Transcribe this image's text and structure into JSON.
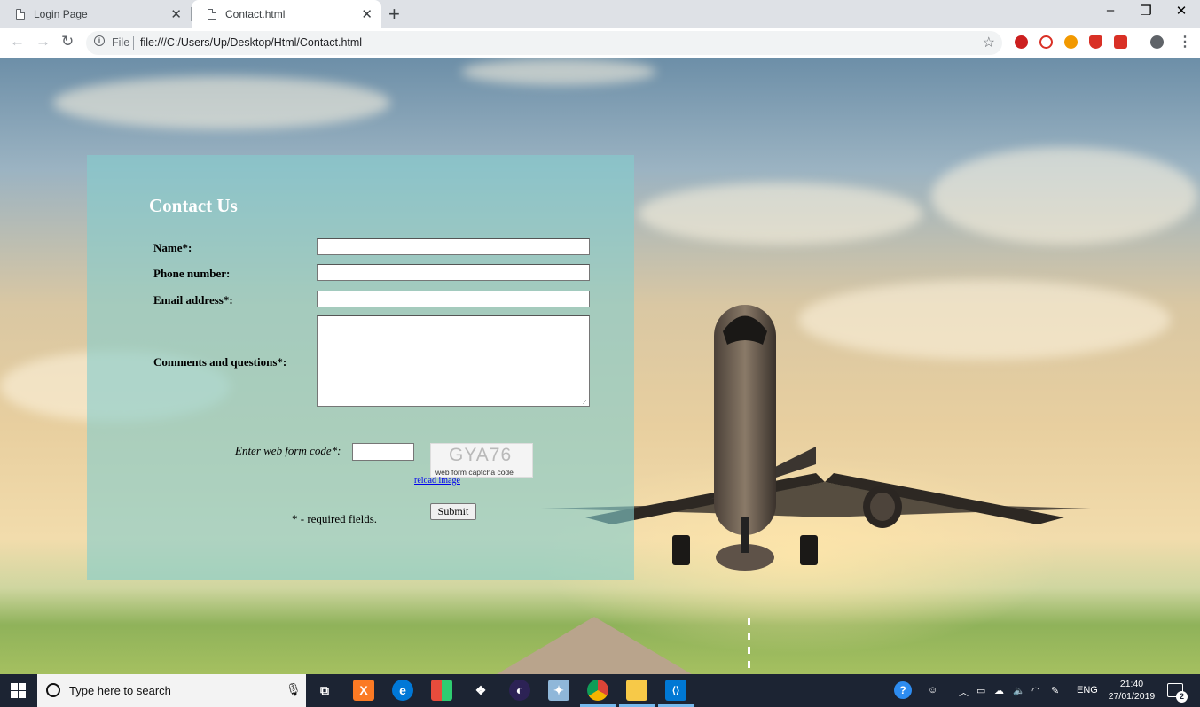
{
  "browser": {
    "tabs": [
      {
        "title": "Login Page",
        "active": false
      },
      {
        "title": "Contact.html",
        "active": true
      }
    ],
    "new_tab": "+",
    "window_controls": {
      "minimize": "‒",
      "maximize": "❐",
      "close": "✕"
    },
    "nav": {
      "back": "←",
      "forward": "→",
      "reload": "↻"
    },
    "omnibox": {
      "info": "i",
      "scheme": "File",
      "url": "file:///C:/Users/Up/Desktop/Html/Contact.html"
    },
    "bookmark_star": "☆",
    "extension_colors": [
      "#cc1f1f",
      "#d93025",
      "#f29900",
      "#d93025",
      "#d93025",
      "#5f6368"
    ],
    "menu": "⋮"
  },
  "contact_form": {
    "title": "Contact Us",
    "fields": [
      {
        "label": "Name*:",
        "value": ""
      },
      {
        "label": "Phone number:",
        "value": ""
      },
      {
        "label": "Email address*:",
        "value": ""
      }
    ],
    "comments_label": "Comments and questions*:",
    "comments_value": "",
    "captcha": {
      "prompt": "Enter web form code*:",
      "code_value": "",
      "image_text": "GYA76",
      "image_caption": "web form captcha code",
      "reload_link": "reload image"
    },
    "required_note": "* - required fields.",
    "submit_label": "Submit"
  },
  "taskbar": {
    "search_placeholder": "Type here to search",
    "pinned_apps": [
      {
        "name": "task-view",
        "color": "#1c2433",
        "glyph": "⧉"
      },
      {
        "name": "xampp",
        "color": "#fb7a24",
        "glyph": "X"
      },
      {
        "name": "edge",
        "color": "#0078d7",
        "glyph": "e"
      },
      {
        "name": "store",
        "color": "#2b2b2b",
        "glyph": "▦"
      },
      {
        "name": "dropbox",
        "color": "#1c2433",
        "glyph": "❖"
      },
      {
        "name": "eclipse",
        "color": "#2c2255",
        "glyph": "◐"
      },
      {
        "name": "bird-app",
        "color": "#8fb7d9",
        "glyph": "✦"
      },
      {
        "name": "chrome",
        "color": "#db4437",
        "glyph": "●"
      },
      {
        "name": "file-explorer",
        "color": "#f7c948",
        "glyph": "▭"
      },
      {
        "name": "visual-studio-code",
        "color": "#0078d4",
        "glyph": "⟨⟩"
      }
    ],
    "tray": {
      "language": "ENG",
      "time": "21:40",
      "date": "27/01/2019",
      "notification_count": "2"
    }
  }
}
